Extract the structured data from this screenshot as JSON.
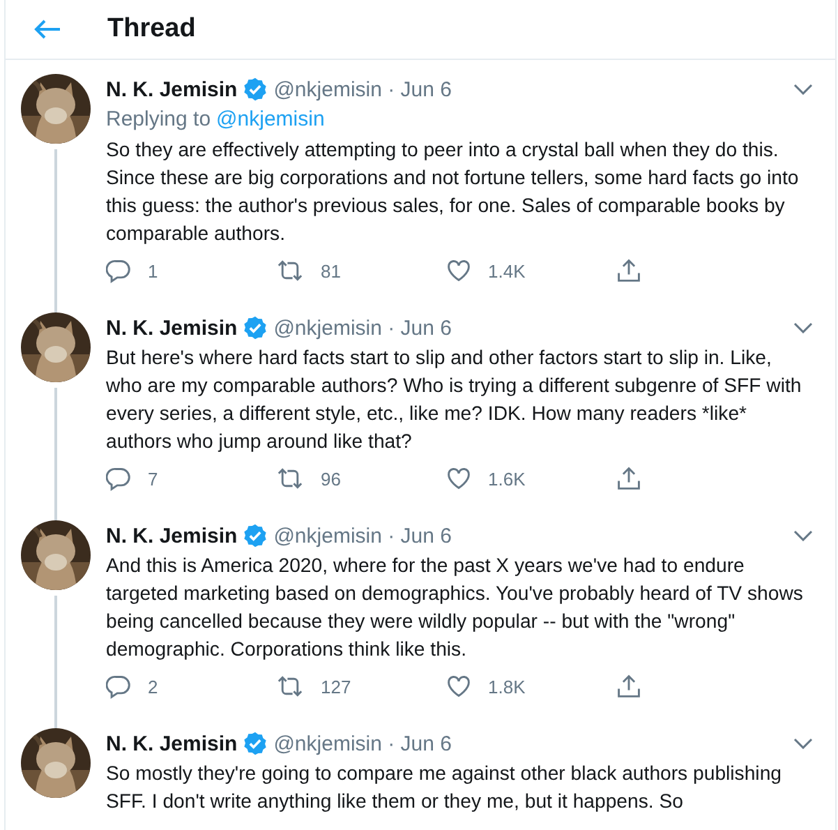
{
  "header": {
    "title": "Thread"
  },
  "tweets": [
    {
      "name": "N. K. Jemisin",
      "verified": true,
      "meta": "@nkjemisin · Jun 6",
      "replying_to": {
        "label": "Replying to",
        "handle": "@nkjemisin"
      },
      "text": "So they are effectively attempting to peer into a crystal ball when they do this. Since these are big corporations and not fortune tellers, some hard facts go into this guess: the author's previous sales, for one. Sales of comparable books by comparable authors.",
      "replies": "1",
      "retweets": "81",
      "likes": "1.4K"
    },
    {
      "name": "N. K. Jemisin",
      "verified": true,
      "meta": "@nkjemisin · Jun 6",
      "text": "But here's where hard facts start to slip and other factors start to slip in. Like, who are my comparable authors? Who is trying a different subgenre of SFF with every series, a different style, etc., like me? IDK. How many readers *like* authors who jump around like that?",
      "replies": "7",
      "retweets": "96",
      "likes": "1.6K"
    },
    {
      "name": "N. K. Jemisin",
      "verified": true,
      "meta": "@nkjemisin · Jun 6",
      "text": "And this is America 2020, where for the past X years we've had to endure targeted marketing based on demographics. You've probably heard of TV shows being cancelled because they were wildly popular -- but with the \"wrong\" demographic. Corporations think like this.",
      "replies": "2",
      "retweets": "127",
      "likes": "1.8K"
    },
    {
      "name": "N. K. Jemisin",
      "verified": true,
      "meta": "@nkjemisin · Jun 6",
      "text": "So mostly they're going to compare me against other black authors publishing SFF. I don't write anything like them or they me, but it happens. So"
    }
  ]
}
